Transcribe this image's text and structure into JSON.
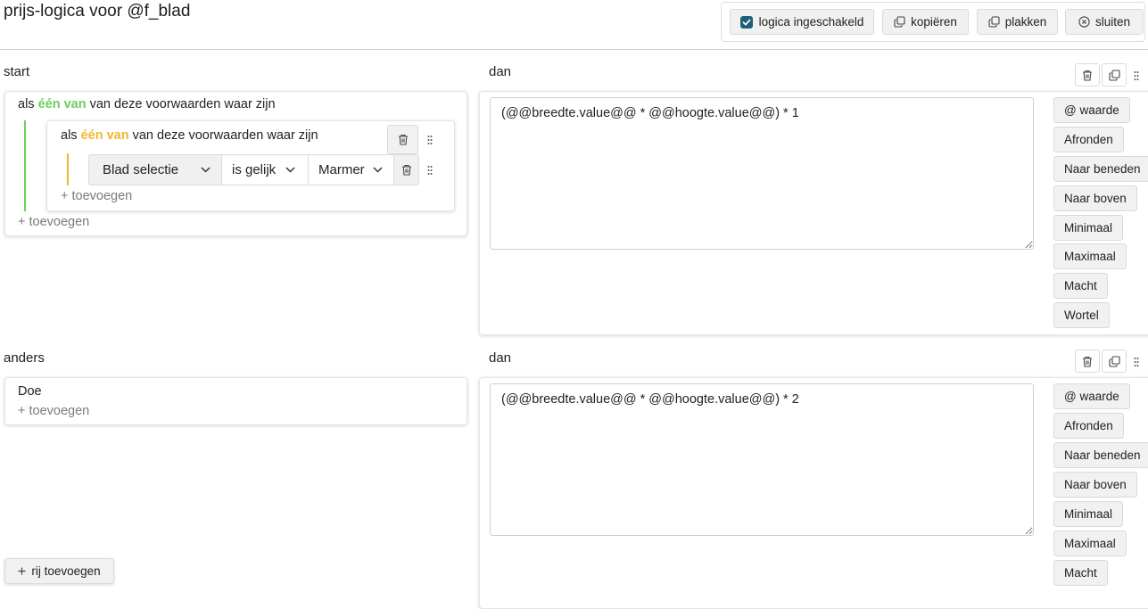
{
  "header": {
    "title": "prijs-logica voor @f_blad",
    "logic_toggle_label": "logica ingeschakeld",
    "copy_label": "kopiëren",
    "paste_label": "plakken",
    "close_label": "sluiten"
  },
  "rows": [
    {
      "left_label": "start",
      "right_label": "dan",
      "condition": {
        "prefix": "als",
        "operator": "één van",
        "suffix": "van deze voorwaarden waar zijn",
        "add_label": "+ toevoegen",
        "nested": {
          "prefix": "als",
          "operator": "één van",
          "suffix": "van deze voorwaarden waar zijn",
          "add_label": "+ toevoegen",
          "rule": {
            "field": "Blad selectie",
            "comparator": "is gelijk",
            "value": "Marmer"
          }
        }
      },
      "expression": "(@@breedte.value@@ * @@hoogte.value@@) * 1"
    },
    {
      "left_label": "anders",
      "right_label": "dan",
      "action": {
        "text": "Doe",
        "add_label": "+ toevoegen"
      },
      "expression": "(@@breedte.value@@ * @@hoogte.value@@) * 2"
    }
  ],
  "function_buttons": [
    "@ waarde",
    "Afronden",
    "Naar beneden",
    "Naar boven",
    "Minimaal",
    "Maximaal",
    "Macht",
    "Wortel"
  ],
  "footer": {
    "add_row_label": "rij toevoegen"
  },
  "colors": {
    "green": "#6bd05b",
    "orange": "#f0b832",
    "checkbox": "#1f5f7a"
  },
  "icons": [
    "checkbox-checked-icon",
    "copy-icon",
    "paste-icon",
    "close-circle-icon",
    "trash-icon",
    "duplicate-icon",
    "drag-handle-icon",
    "chevron-down-icon",
    "plus-icon"
  ]
}
